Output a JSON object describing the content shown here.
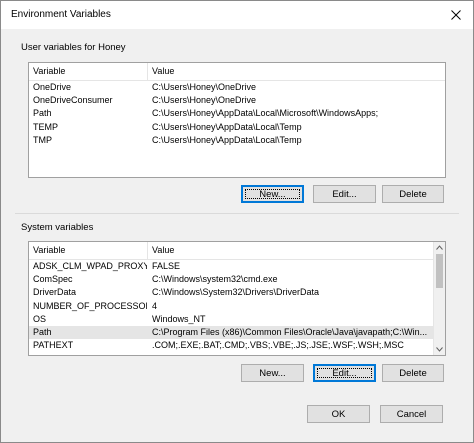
{
  "window": {
    "title": "Environment Variables"
  },
  "user_section": {
    "label": "User variables for Honey",
    "header": {
      "variable": "Variable",
      "value": "Value"
    },
    "rows": [
      {
        "variable": "OneDrive",
        "value": "C:\\Users\\Honey\\OneDrive"
      },
      {
        "variable": "OneDriveConsumer",
        "value": "C:\\Users\\Honey\\OneDrive"
      },
      {
        "variable": "Path",
        "value": "C:\\Users\\Honey\\AppData\\Local\\Microsoft\\WindowsApps;"
      },
      {
        "variable": "TEMP",
        "value": "C:\\Users\\Honey\\AppData\\Local\\Temp"
      },
      {
        "variable": "TMP",
        "value": "C:\\Users\\Honey\\AppData\\Local\\Temp"
      }
    ],
    "buttons": {
      "new": "New...",
      "edit": "Edit...",
      "delete": "Delete"
    }
  },
  "system_section": {
    "label": "System variables",
    "header": {
      "variable": "Variable",
      "value": "Value"
    },
    "rows": [
      {
        "variable": "ADSK_CLM_WPAD_PROXY_...",
        "value": "FALSE"
      },
      {
        "variable": "ComSpec",
        "value": "C:\\Windows\\system32\\cmd.exe"
      },
      {
        "variable": "DriverData",
        "value": "C:\\Windows\\System32\\Drivers\\DriverData"
      },
      {
        "variable": "NUMBER_OF_PROCESSORS",
        "value": "4"
      },
      {
        "variable": "OS",
        "value": "Windows_NT"
      },
      {
        "variable": "Path",
        "value": "C:\\Program Files (x86)\\Common Files\\Oracle\\Java\\javapath;C:\\Win..."
      },
      {
        "variable": "PATHEXT",
        "value": ".COM;.EXE;.BAT;.CMD;.VBS;.VBE;.JS;.JSE;.WSF;.WSH;.MSC"
      }
    ],
    "buttons": {
      "new": "New...",
      "edit": "Edit...",
      "delete": "Delete"
    }
  },
  "footer": {
    "ok": "OK",
    "cancel": "Cancel"
  },
  "colors": {
    "focus": "#0078d7",
    "selected_row": "#e5e5e5"
  }
}
